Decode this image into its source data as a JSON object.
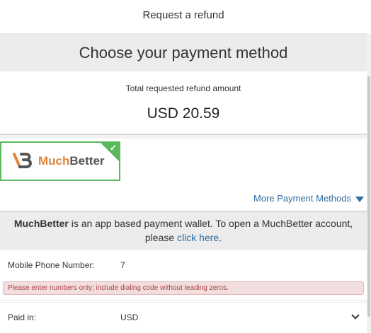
{
  "header": {
    "title": "Request a refund"
  },
  "payment": {
    "heading": "Choose your payment method",
    "amount_label": "Total requested refund amount",
    "amount_value": "USD 20.59"
  },
  "method_tile": {
    "brand_part1": "Much",
    "brand_part2": "Better",
    "selected": true,
    "accent_color": "#5cb85c"
  },
  "more_methods_label": "More Payment Methods",
  "info": {
    "brand": "MuchBetter",
    "text": " is an app based payment wallet. To open a MuchBetter account, please ",
    "link_text": "click here",
    "suffix": "."
  },
  "form": {
    "phone_label": "Mobile Phone Number:",
    "phone_value": "7",
    "phone_error": "Please enter numbers only; include dialing code without leading zeros.",
    "currency_label": "Paid in:",
    "currency_value": "USD"
  }
}
